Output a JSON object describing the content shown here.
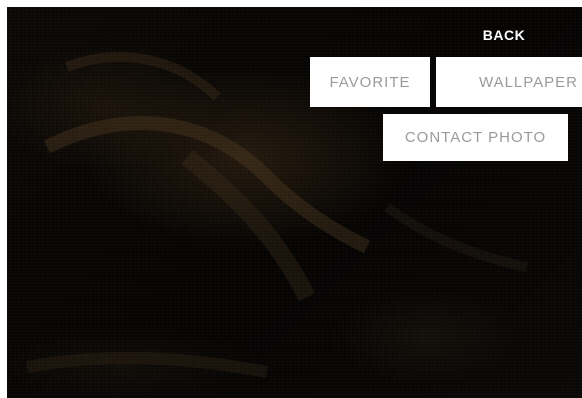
{
  "actions": {
    "back_label": "BACK",
    "favorite_label": "FAVORITE",
    "wallpaper_label": "WALLPAPER",
    "contact_photo_label": "CONTACT PHOTO"
  },
  "colors": {
    "button_bg": "#ffffff",
    "button_text": "#9a9a9a",
    "back_text": "#ffffff",
    "photo_bg": "#050403"
  }
}
